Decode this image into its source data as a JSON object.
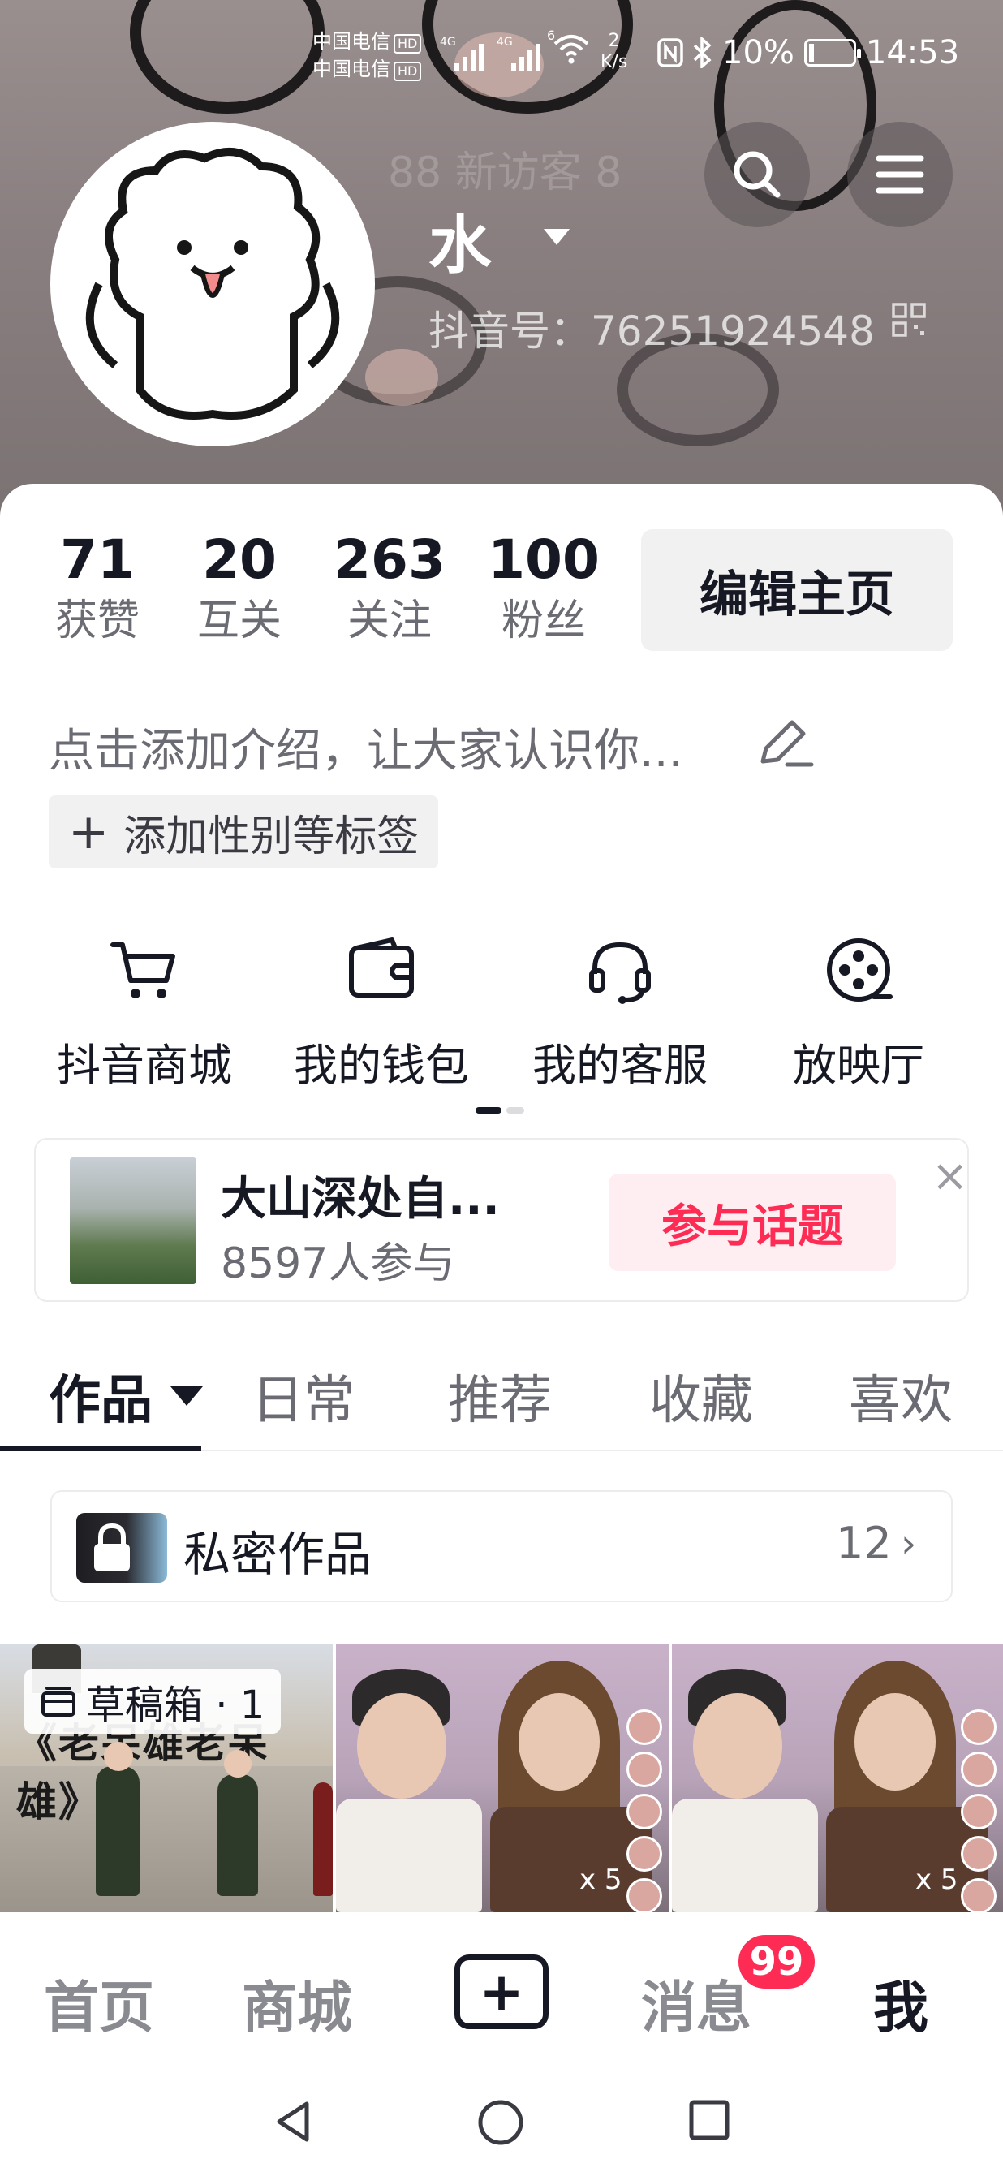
{
  "status_bar": {
    "carrier_1": "中国电信",
    "carrier_2": "中国电信",
    "hd": "HD",
    "sig1": "4G",
    "sig2": "4G",
    "sig3": "6",
    "net_speed_value": "2",
    "net_speed_unit": "K/s",
    "battery": "10%",
    "time": "14:53"
  },
  "header": {
    "name": "水",
    "ghost_text": "88 新访客 8",
    "douyin_id": "抖音号：76251924548",
    "colors": {
      "background": "#8a7f80",
      "text": "#ffffff"
    }
  },
  "stats": [
    {
      "num": "71",
      "label": "获赞"
    },
    {
      "num": "20",
      "label": "互关"
    },
    {
      "num": "263",
      "label": "关注"
    },
    {
      "num": "100",
      "label": "粉丝"
    }
  ],
  "edit_profile_label": "编辑主页",
  "bio_placeholder": "点击添加介绍，让大家认识你...",
  "add_tag_label": "添加性别等标签",
  "services": [
    {
      "label": "抖音商城",
      "icon": "cart-icon"
    },
    {
      "label": "我的钱包",
      "icon": "wallet-icon"
    },
    {
      "label": "我的客服",
      "icon": "headset-icon"
    },
    {
      "label": "放映厅",
      "icon": "film-reel-icon"
    }
  ],
  "topic": {
    "title": "大山深处自...",
    "participants": "8597人参与",
    "join_label": "参与话题",
    "close": "×",
    "accent": "#fe2c55"
  },
  "tabs": [
    {
      "label": "作品",
      "active": true
    },
    {
      "label": "日常"
    },
    {
      "label": "推荐"
    },
    {
      "label": "收藏"
    },
    {
      "label": "喜欢"
    }
  ],
  "private_works": {
    "label": "私密作品",
    "count": "12"
  },
  "videos": {
    "draft_label": "草稿箱 · 1",
    "banner_text": "《老呆雄老呆雄》",
    "multiplier": "x 5"
  },
  "bottom_nav": {
    "items": [
      "首页",
      "商城",
      "消息",
      "我"
    ],
    "active": "我",
    "badge": "99"
  }
}
